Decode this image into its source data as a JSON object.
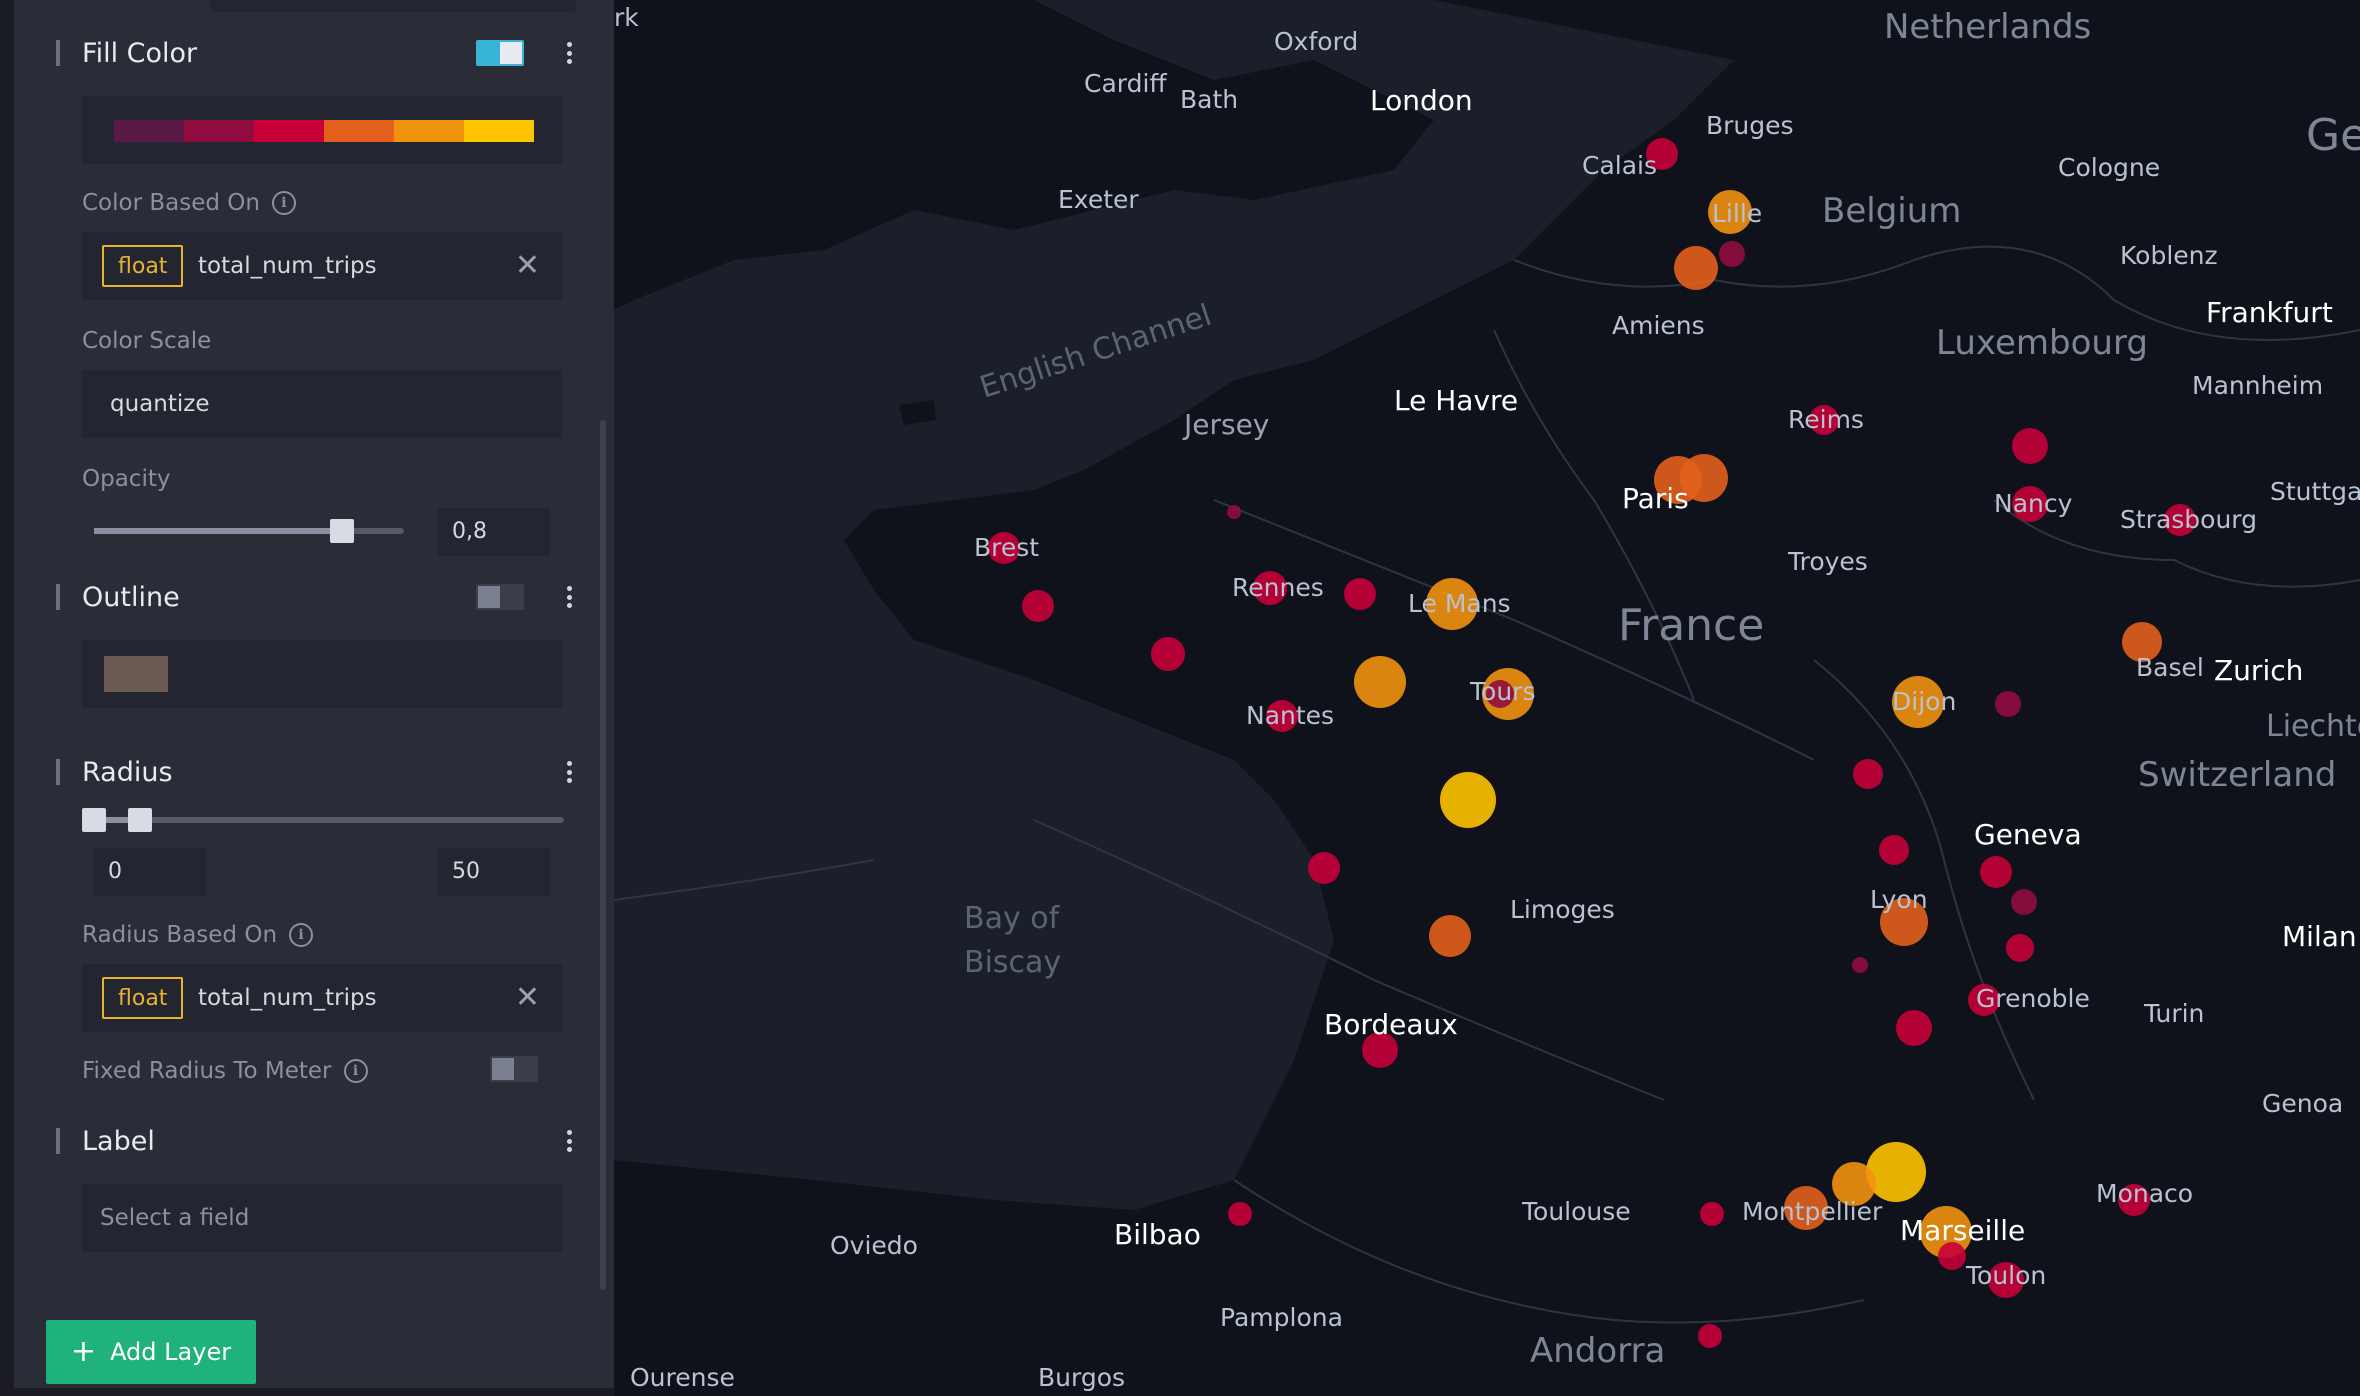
{
  "panel": {
    "fill_color": {
      "title": "Fill Color",
      "palette": [
        "#5a1846",
        "#900c3f",
        "#c70039",
        "#e3611c",
        "#f1920e",
        "#ffc300"
      ],
      "color_based_on_label": "Color Based On",
      "field_type": "float",
      "field_name": "total_num_trips",
      "color_scale_label": "Color Scale",
      "color_scale_value": "quantize",
      "opacity_label": "Opacity",
      "opacity_value": "0,8",
      "opacity_level": 0.8
    },
    "outline": {
      "title": "Outline",
      "color": "#6b5a52",
      "enabled": false
    },
    "radius": {
      "title": "Radius",
      "min_value": "0",
      "max_value": "50",
      "radius_based_on_label": "Radius Based On",
      "field_type": "float",
      "field_name": "total_num_trips",
      "fixed_radius_label": "Fixed Radius To Meter"
    },
    "label": {
      "title": "Label",
      "placeholder": "Select a field"
    },
    "add_layer_label": "Add Layer"
  },
  "map": {
    "countries": [
      "Netherlands",
      "Belgium",
      "Luxembourg",
      "France",
      "Switzerland",
      "Andorra",
      "Ge",
      "Liechte"
    ],
    "water": [
      "English Channel",
      "Bay of",
      "Biscay"
    ],
    "cities_major": [
      "London",
      "Paris",
      "Bordeaux",
      "Geneva",
      "Zurich",
      "Frankfurt",
      "Marseille",
      "Milan",
      "Bilbao",
      "Le Havre",
      "Jersey"
    ],
    "cities_minor": [
      "rk",
      "Oxford",
      "Cardiff",
      "Bath",
      "Exeter",
      "Calais",
      "Bruges",
      "Cologne",
      "Koblenz",
      "Amiens",
      "Mannheim",
      "Reims",
      "Stuttgar",
      "Nancy",
      "Strasbourg",
      "Troyes",
      "Brest",
      "Rennes",
      "Le Mans",
      "Tours",
      "Nantes",
      "Dijon",
      "Basel",
      "Limoges",
      "Lyon",
      "Grenoble",
      "Turin",
      "Genoa",
      "Monaco",
      "Toulouse",
      "Montpellier",
      "Toulon",
      "Oviedo",
      "Pamplona",
      "Burgos",
      "Ourense",
      "Lille"
    ]
  }
}
